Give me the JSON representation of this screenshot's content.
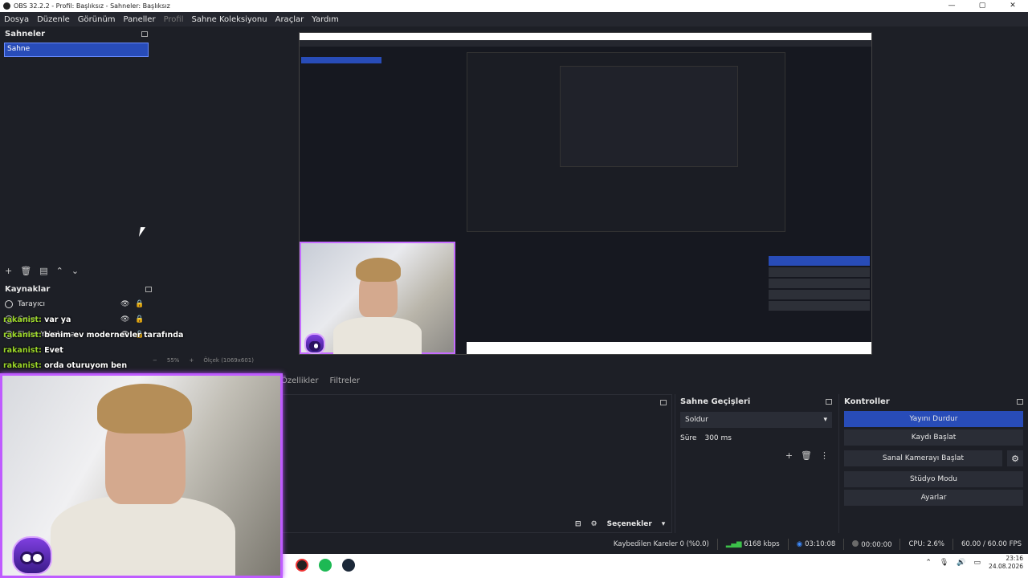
{
  "window": {
    "title": "OBS 32.2.2 - Profil: Başlıksız - Sahneler: Başlıksız",
    "controls": [
      "—",
      "▢",
      "✕"
    ]
  },
  "menu": [
    "Dosya",
    "Düzenle",
    "Görünüm",
    "Paneller",
    "Profil",
    "Sahne Koleksiyonu",
    "Araçlar",
    "Yardım"
  ],
  "scenes": {
    "title": "Sahneler",
    "items": [
      "Sahne"
    ]
  },
  "sources": {
    "title": "Kaynaklar",
    "items": [
      {
        "label": "Tarayıcı"
      },
      {
        "label": "Grup"
      },
      {
        "label": "Ekran Yakalama"
      }
    ]
  },
  "chat": [
    {
      "name": "rakanist:",
      "text": " var ya"
    },
    {
      "name": "rakanist:",
      "text": " benim ev modernevler tarafında"
    },
    {
      "name": "rakanist:",
      "text": " Evet"
    },
    {
      "name": "rakanist:",
      "text": " orda oturuyom ben"
    }
  ],
  "zoom": {
    "level": "55%",
    "resolution": "Ölçek (1069x601)"
  },
  "tabs": {
    "properties": "Özellikler",
    "filters": "Filtreler"
  },
  "transitions": {
    "title": "Sahne Geçişleri",
    "selected": "Soldur",
    "duration_label": "Süre",
    "duration_value": "300 ms"
  },
  "controls": {
    "title": "Kontroller",
    "stop_stream": "Yayını Durdur",
    "start_recording": "Kaydı Başlat",
    "start_virtual_camera": "Sanal Kamerayı Başlat",
    "studio_mode": "Stüdyo Modu",
    "settings": "Ayarlar"
  },
  "options_label": "Seçenekler",
  "status": {
    "dropped_frames": "Kaybedilen Kareler 0 (%0.0)",
    "bitrate": "6168 kbps",
    "stream_time": "03:10:08",
    "record_time": "00:00:00",
    "cpu": "CPU: 2.6%",
    "fps": "60.00 / 60.00 FPS"
  },
  "taskbar": {
    "time": "23:16",
    "date": "24.08.2026"
  },
  "colors": {
    "accent": "#284cb8",
    "webcam_border": "#bf5bff",
    "chat_name": "#9bd62a"
  }
}
